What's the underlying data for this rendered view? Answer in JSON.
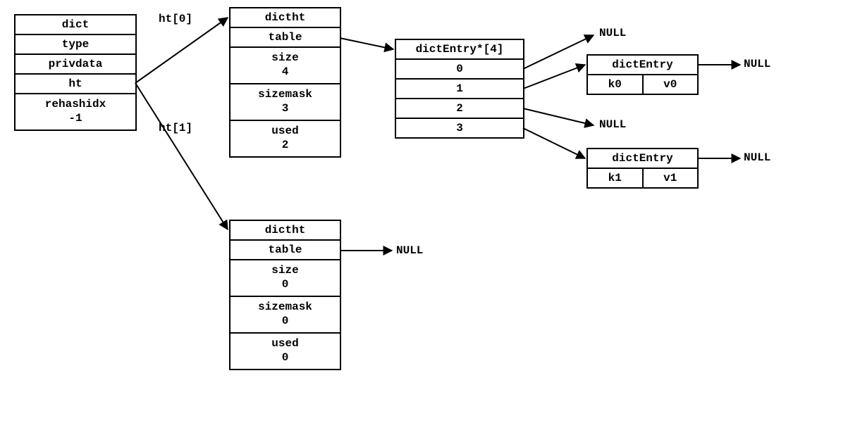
{
  "dict": {
    "title": "dict",
    "fields": [
      "type",
      "privdata",
      "ht"
    ],
    "rehash_label": "rehashidx",
    "rehash_value": "-1"
  },
  "ht_labels": {
    "top": "ht[0]",
    "bottom": "ht[1]"
  },
  "dictht0": {
    "title": "dictht",
    "table_label": "table",
    "size_label": "size",
    "size_value": "4",
    "sizemask_label": "sizemask",
    "sizemask_value": "3",
    "used_label": "used",
    "used_value": "2"
  },
  "dictht1": {
    "title": "dictht",
    "table_label": "table",
    "size_label": "size",
    "size_value": "0",
    "sizemask_label": "sizemask",
    "sizemask_value": "0",
    "used_label": "used",
    "used_value": "0"
  },
  "entryArray": {
    "title": "dictEntry*[4]",
    "indices": [
      "0",
      "1",
      "2",
      "3"
    ]
  },
  "entry0": {
    "title": "dictEntry",
    "key": "k0",
    "value": "v0"
  },
  "entry1": {
    "title": "dictEntry",
    "key": "k1",
    "value": "v1"
  },
  "nulls": {
    "slot0": "NULL",
    "slot2": "NULL",
    "afterE0": "NULL",
    "afterE1": "NULL",
    "ht1table": "NULL"
  }
}
